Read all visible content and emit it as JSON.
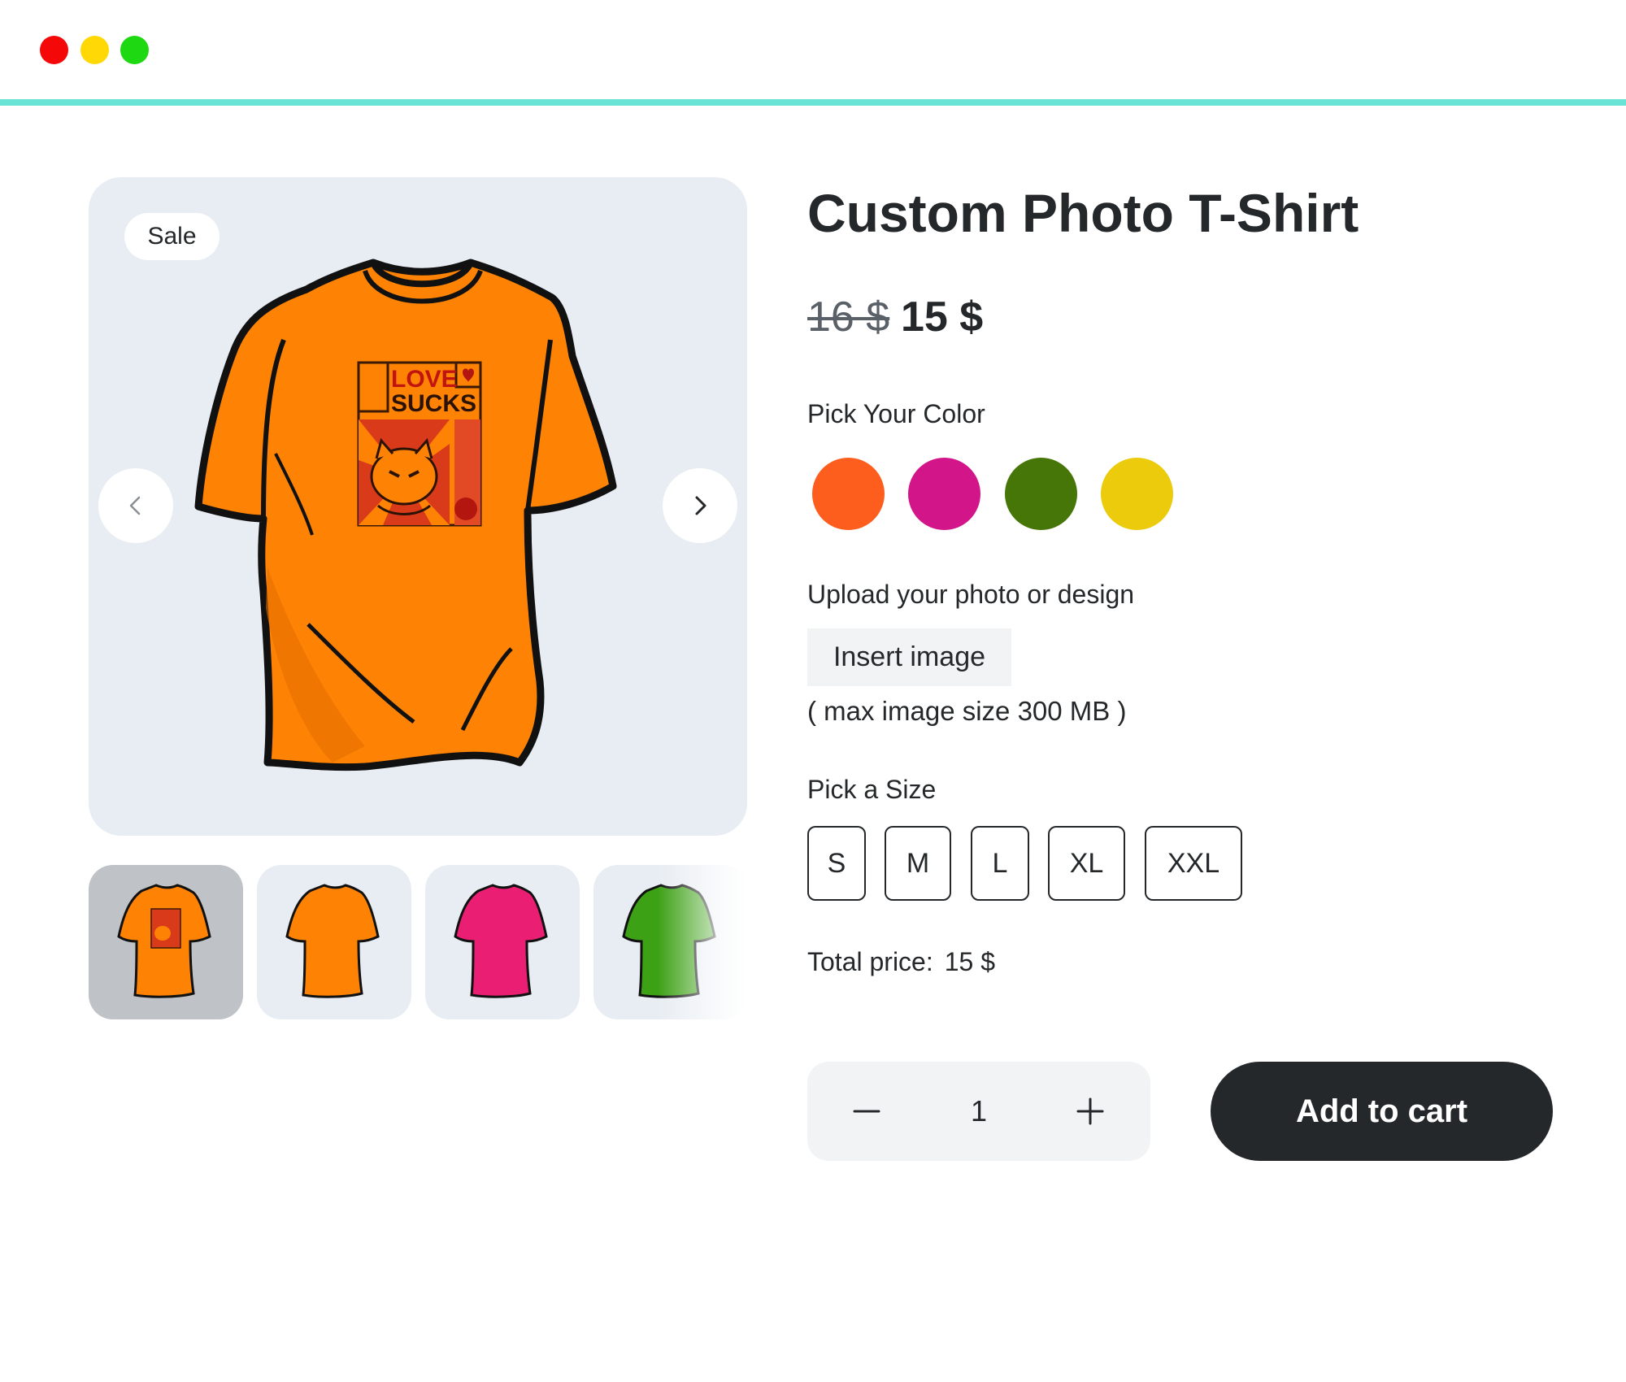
{
  "window": {
    "controls": [
      "close",
      "minimize",
      "maximize"
    ],
    "colors": {
      "close": "#f40808",
      "minimize": "#ffd806",
      "maximize": "#1ed811",
      "accent_line": "#6ae3d7"
    }
  },
  "gallery": {
    "badge": "Sale",
    "main_image": "orange-t-shirt-with-print",
    "print_text": [
      "LOVE",
      "SUCKS"
    ],
    "prev_icon": "chevron-left-icon",
    "next_icon": "chevron-right-icon",
    "thumbnails": [
      {
        "name": "orange-printed",
        "color": "#fe8304",
        "selected": true
      },
      {
        "name": "orange",
        "color": "#fe8304",
        "selected": false
      },
      {
        "name": "pink",
        "color": "#ea1f73",
        "selected": false
      },
      {
        "name": "green",
        "color": "#3da116",
        "selected": false
      }
    ]
  },
  "product": {
    "title": "Custom Photo T-Shirt",
    "old_price": "16 $",
    "new_price": "15 $"
  },
  "color_picker": {
    "label": "Pick Your Color",
    "colors": [
      "#fd5d1d",
      "#d21689",
      "#467508",
      "#ebcb0b"
    ]
  },
  "upload": {
    "label": "Upload your photo or design",
    "button_label": "Insert image",
    "hint": "( max image size 300 MB )"
  },
  "size_picker": {
    "label": "Pick a Size",
    "sizes": [
      "S",
      "M",
      "L",
      "XL",
      "XXL"
    ]
  },
  "total": {
    "label": "Total price:",
    "value": "15 $"
  },
  "quantity": {
    "value": "1",
    "minus_icon": "minus-icon",
    "plus_icon": "plus-icon"
  },
  "cart": {
    "button_label": "Add to cart"
  }
}
